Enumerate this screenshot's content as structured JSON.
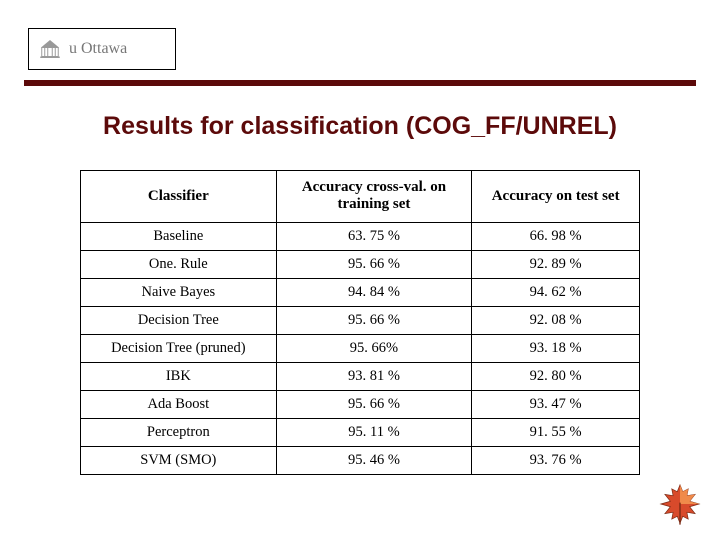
{
  "logo": {
    "text": "u Ottawa"
  },
  "title": "Results for classification (COG_FF/UNREL)",
  "table": {
    "headers": [
      "Classifier",
      "Accuracy cross-val. on training set",
      "Accuracy on test set"
    ],
    "rows": [
      {
        "classifier": "Baseline",
        "train": "63. 75 %",
        "test": "66. 98 %"
      },
      {
        "classifier": "One. Rule",
        "train": "95. 66 %",
        "test": "92. 89 %"
      },
      {
        "classifier": "Naive Bayes",
        "train": "94. 84 %",
        "test": "94. 62 %"
      },
      {
        "classifier": "Decision Tree",
        "train": "95. 66 %",
        "test": "92. 08 %"
      },
      {
        "classifier": "Decision Tree (pruned)",
        "train": "95. 66%",
        "test": "93. 18 %"
      },
      {
        "classifier": "IBK",
        "train": "93. 81 %",
        "test": "92. 80 %"
      },
      {
        "classifier": "Ada Boost",
        "train": "95. 66 %",
        "test": "93. 47 %"
      },
      {
        "classifier": "Perceptron",
        "train": "95. 11 %",
        "test": "91. 55 %"
      },
      {
        "classifier": "SVM (SMO)",
        "train": "95. 46 %",
        "test": "93. 76 %"
      }
    ]
  }
}
